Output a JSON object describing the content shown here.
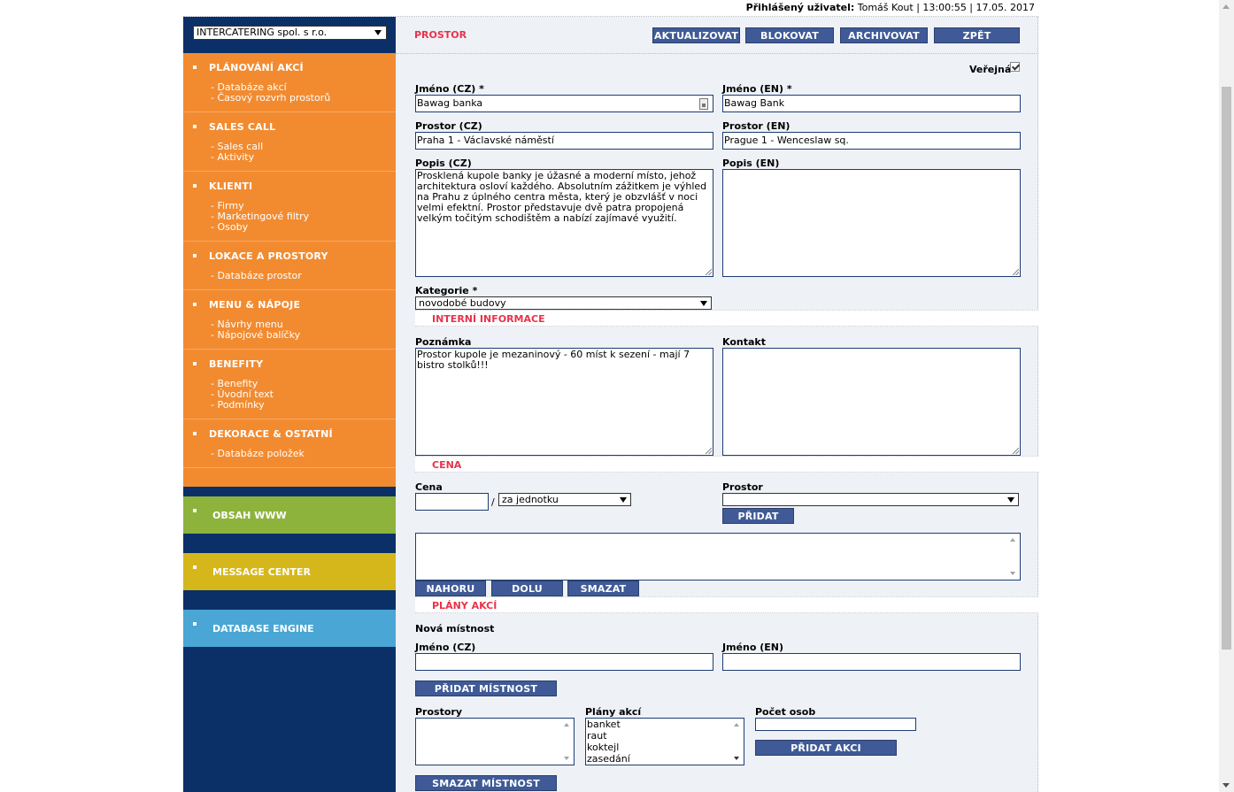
{
  "topbar": {
    "user_label": "Přihlášený uživatel:",
    "user_info": "Tomáš Kout | 13:00:55 | 17.05. 2017"
  },
  "sidebar": {
    "company": "INTERCATERING spol. s r.o.",
    "sections": [
      {
        "title": "PLÁNOVÁNÍ AKCÍ",
        "links": [
          "- Databáze akcí",
          "- Časový rozvrh prostorů"
        ]
      },
      {
        "title": "SALES CALL",
        "links": [
          "- Sales call",
          "- Aktivity"
        ]
      },
      {
        "title": "KLIENTI",
        "links": [
          "- Firmy",
          "- Marketingové filtry",
          "- Osoby"
        ]
      },
      {
        "title": "LOKACE A PROSTORY",
        "links": [
          "- Databáze prostor"
        ]
      },
      {
        "title": "MENU & NÁPOJE",
        "links": [
          "- Návrhy menu",
          "- Nápojové balíčky"
        ]
      },
      {
        "title": "BENEFITY",
        "links": [
          "- Benefity",
          "- Úvodní text",
          "- Podmínky"
        ]
      },
      {
        "title": "DEKORACE & OSTATNÍ",
        "links": [
          "- Databáze položek"
        ]
      }
    ],
    "blocks": [
      {
        "title": "OBSAH WWW",
        "color": "#8db33c"
      },
      {
        "title": "MESSAGE CENTER",
        "color": "#d6b71b"
      },
      {
        "title": "DATABASE ENGINE",
        "color": "#4aa6d4"
      }
    ]
  },
  "colors": {
    "sidebar_bg": "#0b3068",
    "orange": "#f28b30",
    "button": "#3f5a96",
    "section_red": "#e8334a",
    "panel_bg": "#eef1f6"
  },
  "header": {
    "title": "PROSTOR",
    "buttons": [
      "AKTUALIZOVAT",
      "BLOKOVAT",
      "ARCHIVOVAT",
      "ZPĚT"
    ]
  },
  "form": {
    "public_label": "Veřejná",
    "public_checked": true,
    "name_cz_label": "Jméno (CZ) *",
    "name_cz": "Bawag banka",
    "name_en_label": "Jméno (EN) *",
    "name_en": "Bawag Bank",
    "space_cz_label": "Prostor (CZ)",
    "space_cz": "Praha 1 - Václavské náměstí",
    "space_en_label": "Prostor (EN)",
    "space_en": "Prague 1 - Wenceslaw sq.",
    "desc_cz_label": "Popis (CZ)",
    "desc_cz": "Prosklená kupole banky je úžasné a moderní místo, jehož architektura osloví každého. Absolutním zážitkem je výhled na Prahu z úplného centra města, který je obzvlášť v noci velmi efektní. Prostor představuje dvě patra propojená velkým točitým schodištěm a nabízí zajímavé využití.",
    "desc_en_label": "Popis (EN)",
    "desc_en": "",
    "category_label": "Kategorie *",
    "category": "novodobé budovy"
  },
  "internal": {
    "section": "INTERNÍ INFORMACE",
    "note_label": "Poznámka",
    "note": "Prostor kupole je mezaninový - 60 míst k sezení - mají 7 bistro stolků!!!",
    "contact_label": "Kontakt",
    "contact": ""
  },
  "price": {
    "section": "CENA",
    "price_label": "Cena",
    "price_value": "",
    "slash": "/",
    "unit": "za jednotku",
    "space_label": "Prostor",
    "space_value": "",
    "add_button": "PŘIDAT",
    "buttons": [
      "NAHORU",
      "DOLU",
      "SMAZAT"
    ]
  },
  "plans": {
    "section": "PLÁNY AKCÍ",
    "new_room": "Nová místnost",
    "name_cz_label": "Jméno (CZ)",
    "name_en_label": "Jméno (EN)",
    "add_room_button": "PŘIDAT MÍSTNOST",
    "spaces_label": "Prostory",
    "plans_label": "Plány akcí",
    "plan_options": [
      "banket",
      "raut",
      "koktejl",
      "zasedání"
    ],
    "persons_label": "Počet osob",
    "add_action_button": "PŘIDAT AKCI",
    "delete_room_button": "SMAZAT MÍSTNOST"
  }
}
